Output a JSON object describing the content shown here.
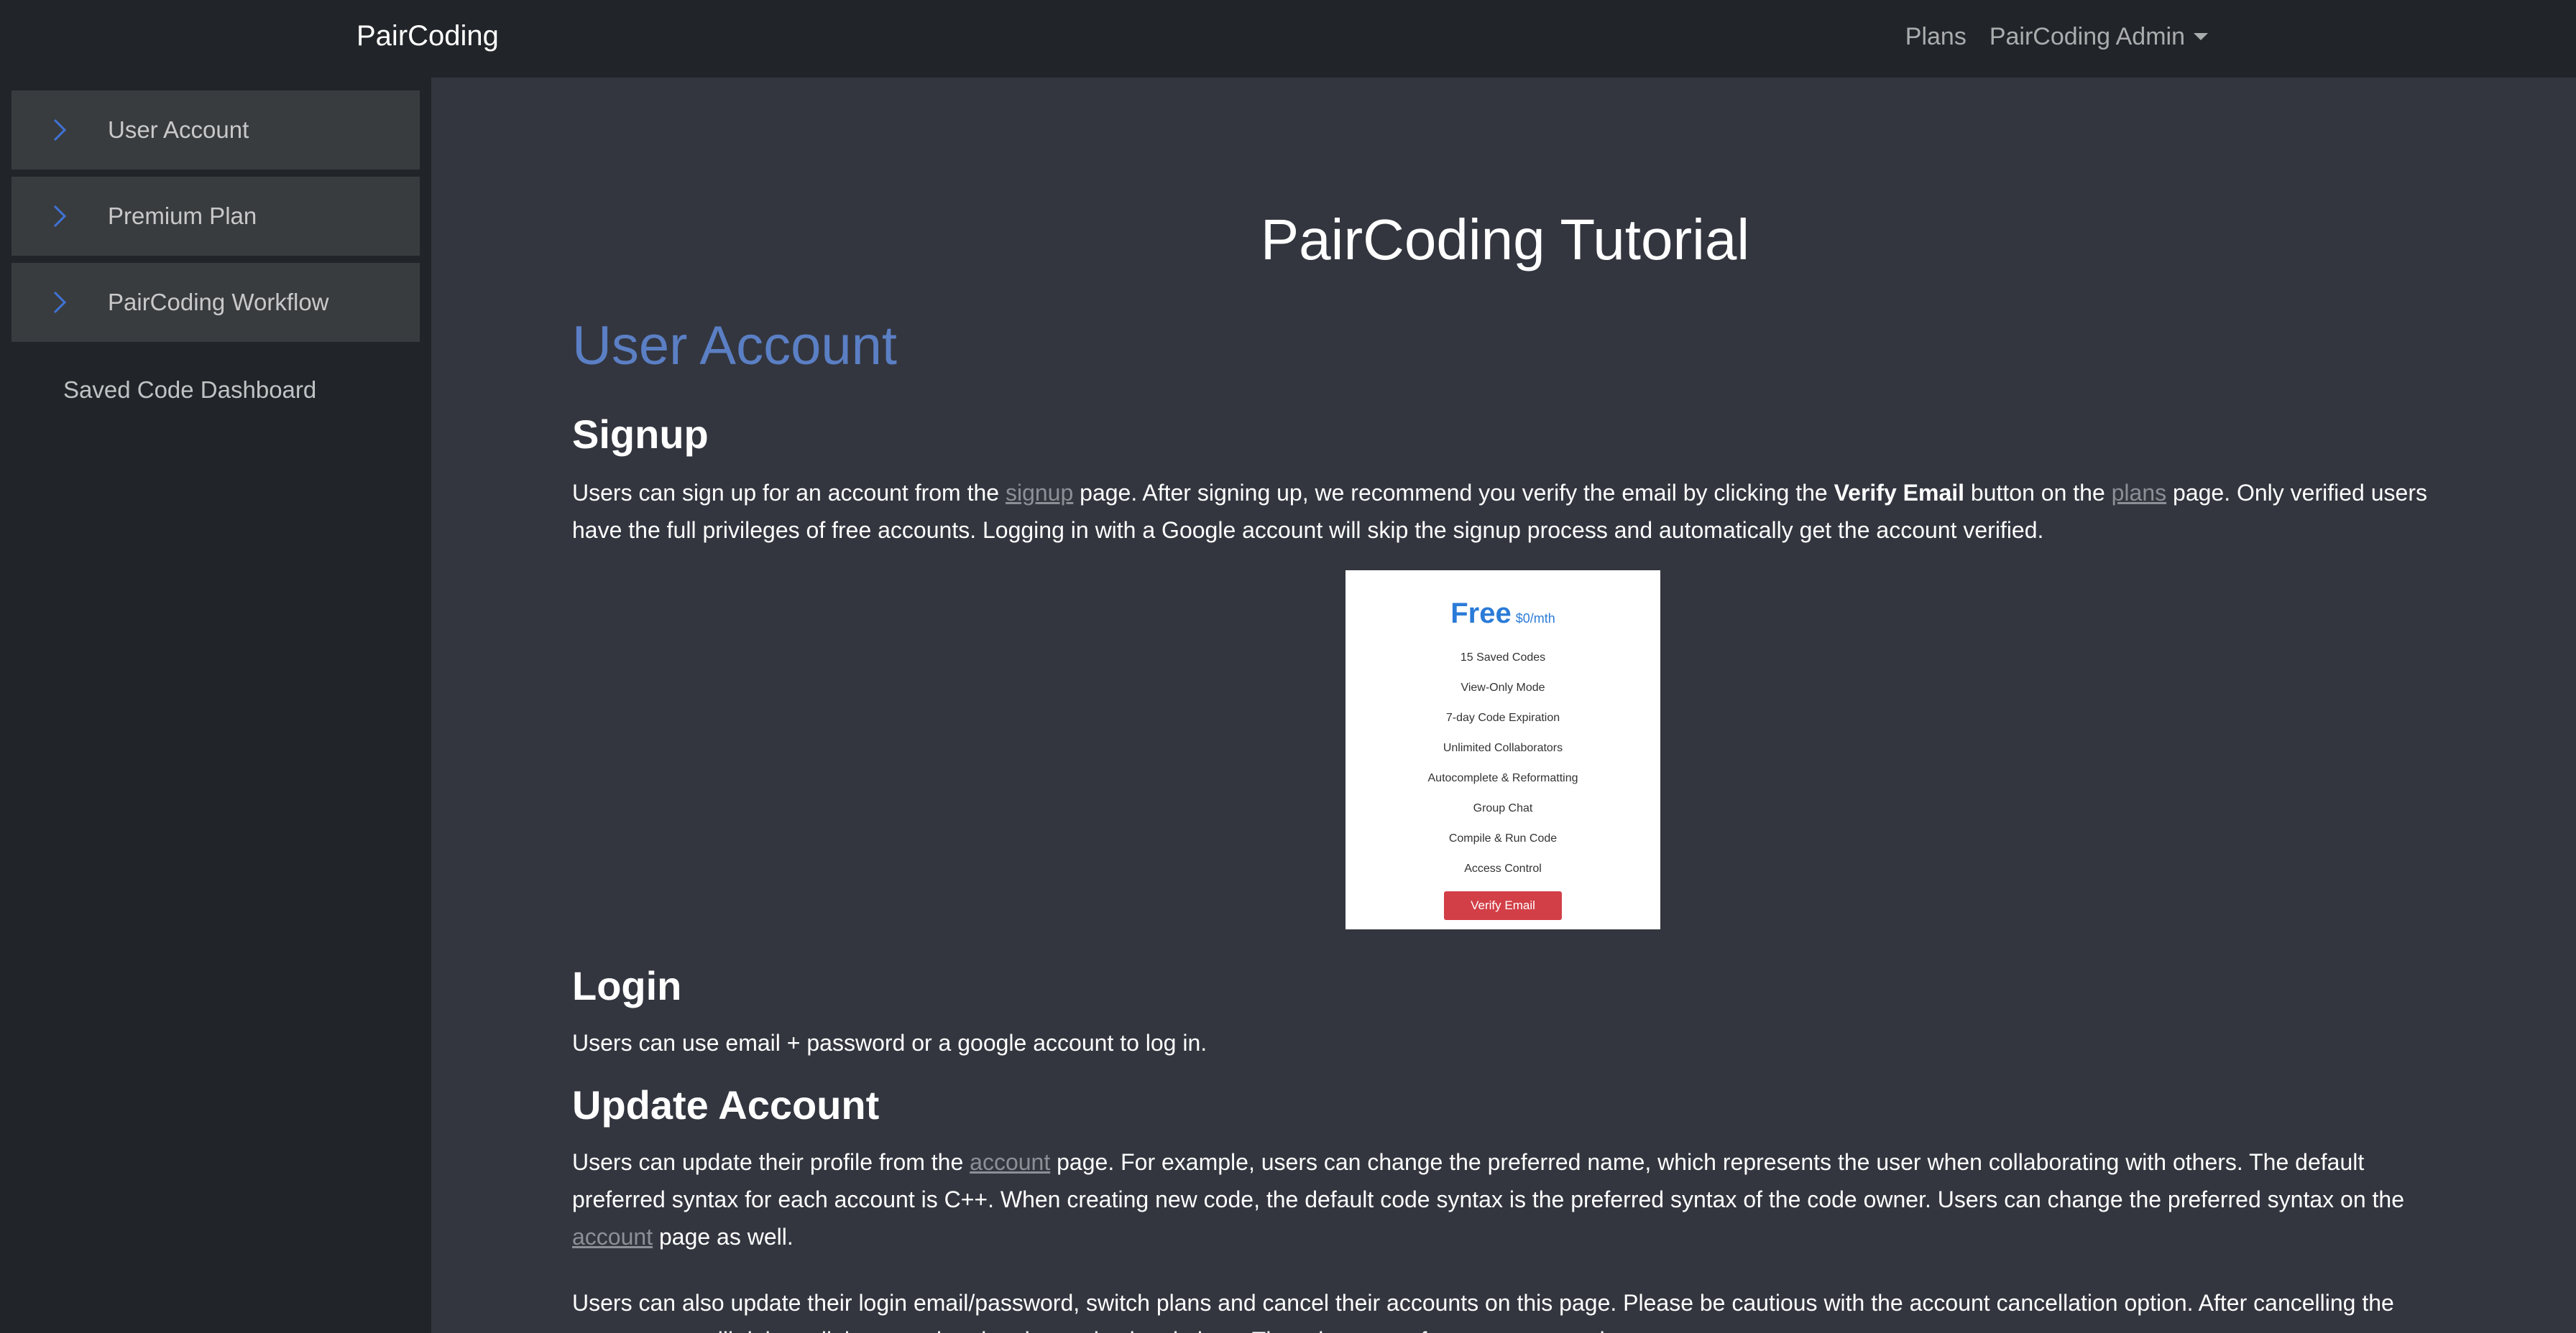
{
  "navbar": {
    "brand": "PairCoding",
    "plans_label": "Plans",
    "admin_label": "PairCoding Admin"
  },
  "sidebar": {
    "items": [
      {
        "label": "User Account"
      },
      {
        "label": "Premium Plan"
      },
      {
        "label": "PairCoding Workflow"
      }
    ],
    "plain_item": "Saved Code Dashboard"
  },
  "main": {
    "title": "PairCoding Tutorial",
    "section_title": "User Account",
    "signup": {
      "heading": "Signup",
      "p1_a": "Users can sign up for an account from the ",
      "p1_link1": "signup",
      "p1_b": " page. After signing up, we recommend you verify the email by clicking the ",
      "p1_bold": "Verify Email",
      "p1_c": " button on the ",
      "p1_link2": "plans",
      "p1_d": " page. Only verified users have the full privileges of free accounts. Logging in with a Google account will skip the signup process and automatically get the account verified."
    },
    "plan_card": {
      "name": "Free",
      "price": "$0/mth",
      "features": [
        "15 Saved Codes",
        "View-Only Mode",
        "7-day Code Expiration",
        "Unlimited Collaborators",
        "Autocomplete & Reformatting",
        "Group Chat",
        "Compile & Run Code",
        "Access Control"
      ],
      "button": "Verify Email"
    },
    "login": {
      "heading": "Login",
      "text": "Users can use email + password or a google account to log in."
    },
    "update": {
      "heading": "Update Account",
      "p1_a": "Users can update their profile from the ",
      "p1_link1": "account",
      "p1_b": " page. For example, users can change the preferred name, which represents the user when collaborating with others. The default preferred syntax for each account is C++. When creating new code, the default code syntax is the preferred syntax of the code owner. Users can change the preferred syntax on the ",
      "p1_link2": "account",
      "p1_c": " page as well.",
      "p2": "Users can also update their login email/password, switch plans and cancel their accounts on this page. Please be cautious with the account cancellation option. After cancelling the account, we will delete all the associated codes and subscriptions. There is no way for us to recover the account."
    }
  },
  "colors": {
    "navbar_bg": "#212529",
    "main_bg": "#33363f",
    "sidebar_item_bg": "#393c3f",
    "section_title": "#5b7fc4",
    "chevron": "#3f73d6",
    "verify_button": "#d23f47"
  },
  "icons": {
    "sidebar_chevron": "chevron-right-icon",
    "dropdown_caret": "caret-down-icon"
  }
}
